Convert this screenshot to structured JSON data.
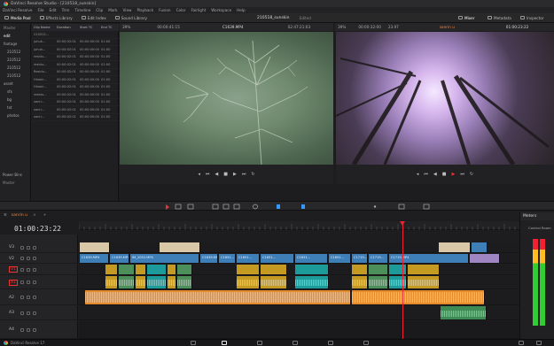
{
  "window": {
    "title": "DaVinci Resolve Studio - [210518_sunskin]"
  },
  "menu": [
    "DaVinci Resolve",
    "File",
    "Edit",
    "Trim",
    "Timeline",
    "Clip",
    "Mark",
    "View",
    "Playback",
    "Fusion",
    "Color",
    "Fairlight",
    "Workspace",
    "Help"
  ],
  "toolbar": {
    "media_pool": "Media Pool",
    "effects_library": "Effects Library",
    "edit_index": "Edit Index",
    "sound_library": "Sound Library",
    "project_name": "210518_sunskin",
    "edited": "Edited",
    "mixer": "Mixer",
    "metadata": "Metadata",
    "inspector": "Inspector"
  },
  "bins": {
    "header": "Master",
    "items": [
      "edit",
      "footage",
      "210512",
      "210512",
      "210512",
      "210512",
      "asset",
      "sfx",
      "bg",
      "txt",
      "photos"
    ],
    "power_bins": "Power Bins",
    "power_master": "Master"
  },
  "cliplist": {
    "columns": [
      "Clip Name",
      "Duration",
      "Start TC",
      "End TC"
    ],
    "rows": [
      [
        "210512...",
        "",
        "",
        ""
      ],
      [
        "juhuk...",
        "00:00:02:01",
        "00:00:00:00",
        "01:00"
      ],
      [
        "juhuk...",
        "00:00:02:01",
        "00:00:00:00",
        "01:00"
      ],
      [
        "residu...",
        "00:00:02:01",
        "00:00:00:00",
        "01:00"
      ],
      [
        "residu...",
        "00:00:02:01",
        "00:00:00:00",
        "01:00"
      ],
      [
        "Residu...",
        "00:00:02:01",
        "00:00:00:00",
        "01:00"
      ],
      [
        "Hirwin...",
        "00:00:02:01",
        "00:00:00:00",
        "01:00"
      ],
      [
        "Hirwin...",
        "00:00:02:01",
        "00:00:00:00",
        "01:00"
      ],
      [
        "residu...",
        "00:00:02:01",
        "00:00:00:00",
        "01:00"
      ],
      [
        "sanri...",
        "00:00:02:01",
        "00:00:00:00",
        "01:00"
      ],
      [
        "sanri...",
        "00:00:02:01",
        "00:00:00:00",
        "01:00"
      ],
      [
        "sanri...",
        "00:00:02:01",
        "00:00:00:00",
        "01:00"
      ]
    ]
  },
  "source_viewer": {
    "zoom": "39%",
    "tc_left": "00:00:41:15",
    "clip": "C1639.MP4",
    "tc_right": "02:47:21:03"
  },
  "program_viewer": {
    "zoom": "39%",
    "tc_left": "00:00:32:00",
    "fps": "23.97",
    "timeline": "sanrin u",
    "tc_right": "01:00:23:22"
  },
  "timeline": {
    "tab": "sanrin u",
    "timecode": "01:00:23:22",
    "tracks": [
      {
        "label": "V3",
        "type": "video"
      },
      {
        "label": "V2",
        "type": "video"
      },
      {
        "label": "V1",
        "type": "video"
      },
      {
        "label": "A1",
        "type": "audio"
      },
      {
        "label": "A2",
        "type": "audio"
      },
      {
        "label": "A3",
        "type": "audio"
      },
      {
        "label": "A4",
        "type": "audio"
      }
    ],
    "v2_clips": [
      "C1639.MP4",
      "C1639.MP4",
      "IM_2052.MP4",
      "C1639.MP4",
      "C1651...",
      "C1651...",
      "C1651...",
      "C1651...",
      "C1651...",
      "C1719...",
      "C1719...",
      "C1719.MP4"
    ]
  },
  "meters": {
    "title": "Meters",
    "room": "Control Room"
  },
  "status": {
    "app": "DaVinci Resolve 17"
  },
  "colors": {
    "accent": "#e23",
    "clip_blue": "#3f7fb8",
    "clip_orange": "#e58a2a",
    "clip_green": "#4c8f5a",
    "clip_gold": "#c49a22",
    "clip_teal": "#1d9b9b"
  }
}
